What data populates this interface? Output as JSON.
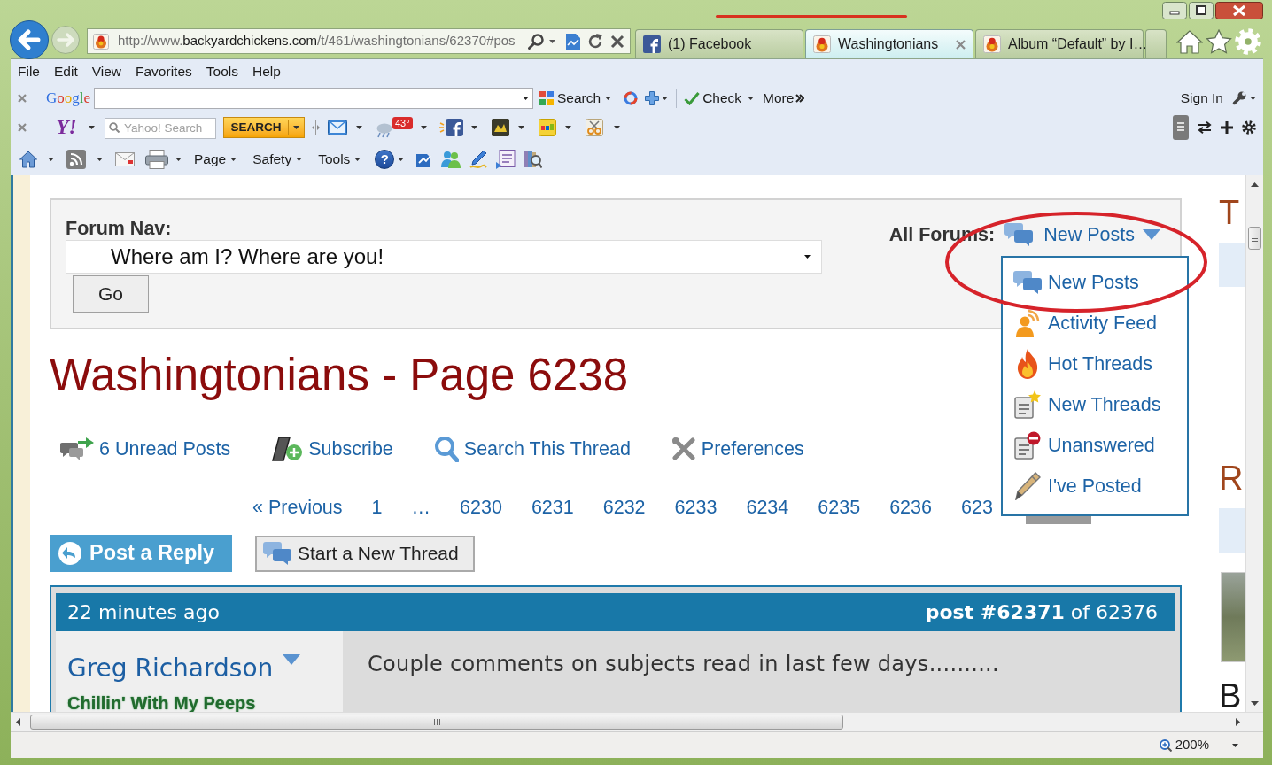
{
  "address_bar": {
    "url": [
      {
        "text": "http://www.",
        "strong": false
      },
      {
        "text": "backyardchickens.com",
        "strong": true
      },
      {
        "text": "/t/461/washingtonians/62370#pos",
        "strong": false
      }
    ]
  },
  "tabs": [
    {
      "label": "(1) Facebook",
      "kind": "facebook",
      "selected": false
    },
    {
      "label": "Washingtonians",
      "kind": "forum",
      "selected": true
    },
    {
      "label": "Album “Default” by I…",
      "kind": "forum",
      "selected": false
    }
  ],
  "menu_bar": [
    "File",
    "Edit",
    "View",
    "Favorites",
    "Tools",
    "Help"
  ],
  "google_toolbar": {
    "logo": "Google",
    "search_button": "Search",
    "check_button": "Check",
    "more_button": "More",
    "sign_in": "Sign In"
  },
  "yahoo_toolbar": {
    "logo": "Y!",
    "search_placeholder": "Yahoo! Search",
    "search_button": "SEARCH",
    "weather_badge": "43°"
  },
  "command_bar": {
    "menus": [
      "Page",
      "Safety",
      "Tools"
    ],
    "help": "?"
  },
  "forum_nav": {
    "label": "Forum Nav:",
    "select_value": "Where am I? Where are you!",
    "go_button": "Go"
  },
  "all_forums": {
    "label": "All Forums:",
    "current": "New Posts",
    "expanded": true,
    "menu": [
      {
        "label": "New Posts",
        "kind": "posts"
      },
      {
        "label": "Activity Feed",
        "kind": "activity"
      },
      {
        "label": "Hot Threads",
        "kind": "hot"
      },
      {
        "label": "New Threads",
        "kind": "new"
      },
      {
        "label": "Unanswered",
        "kind": "unanswered"
      },
      {
        "label": "I've Posted",
        "kind": "posted"
      }
    ]
  },
  "title": "Washingtonians - Page 6238",
  "thread_actions": [
    {
      "label": "6 Unread Posts",
      "kind": "unread"
    },
    {
      "label": "Subscribe",
      "kind": "subscribe"
    },
    {
      "label": "Search This Thread",
      "kind": "search"
    },
    {
      "label": "Preferences",
      "kind": "preferences"
    }
  ],
  "pagination": [
    "« Previous",
    "1",
    "…",
    "6230",
    "6231",
    "6232",
    "6233",
    "6234",
    "6235",
    "6236",
    "623"
  ],
  "reply_buttons": {
    "post_reply": "Post a Reply",
    "new_thread": "Start a New Thread"
  },
  "post": {
    "time": "22 minutes ago",
    "number": "**post #62371** of 62376",
    "author": "Greg Richardson",
    "author_title": "Chillin' With My Peeps",
    "body": "Couple comments on subjects read in last few days.........."
  },
  "sidebar": {
    "headings": [
      {
        "text": "T",
        "kind": "section"
      },
      {
        "text": "R",
        "kind": "section"
      },
      {
        "text": "B",
        "kind": "caption"
      }
    ]
  },
  "status_bar": {
    "zoom": "200%"
  }
}
